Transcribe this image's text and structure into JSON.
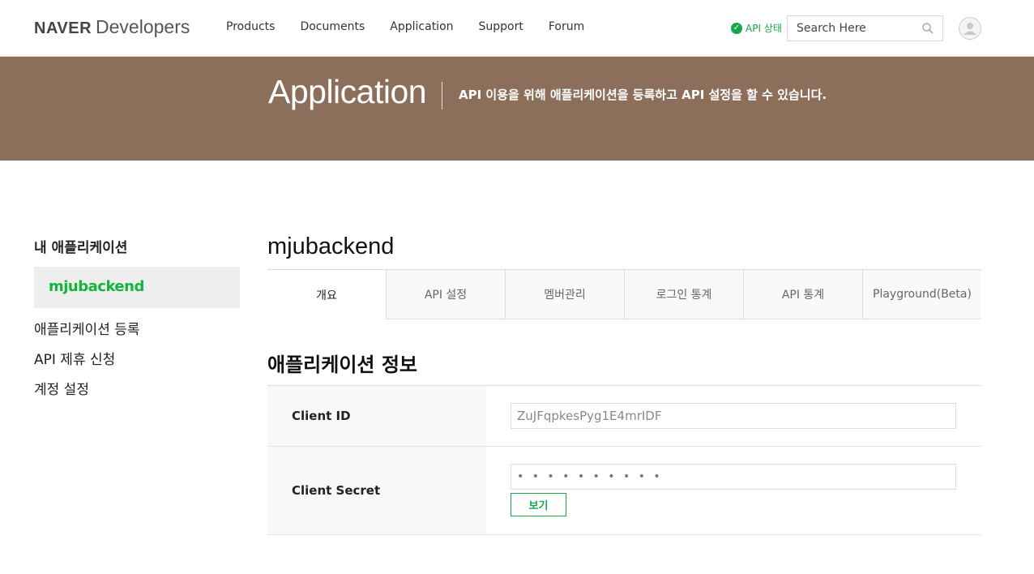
{
  "header": {
    "logo_brand": "NAVER",
    "logo_product": "Developers",
    "nav": [
      "Products",
      "Documents",
      "Application",
      "Support",
      "Forum"
    ],
    "api_status": "API 상태",
    "search_placeholder": "Search Here"
  },
  "banner": {
    "title": "Application",
    "description": "API 이용을 위해 애플리케이션을 등록하고 API 설정을 할 수 있습니다."
  },
  "sidebar": {
    "title": "내 애플리케이션",
    "active_app": "mjubackend",
    "links": [
      "애플리케이션 등록",
      "API 제휴 신청",
      "계정 설정"
    ]
  },
  "main": {
    "app_name": "mjubackend",
    "tabs": [
      "개요",
      "API 설정",
      "멤버관리",
      "로그인 통계",
      "API 통계",
      "Playground(Beta)"
    ],
    "active_tab": "개요",
    "section_title": "애플리케이션 정보",
    "client_id_label": "Client ID",
    "client_id_value": "ZuJFqpkesPyg1E4mrIDF",
    "client_secret_label": "Client Secret",
    "client_secret_value": "• • • • • • • • • •",
    "show_button": "보기"
  },
  "colors": {
    "banner": "#8b6f5a",
    "accent_green": "#19a64a"
  }
}
